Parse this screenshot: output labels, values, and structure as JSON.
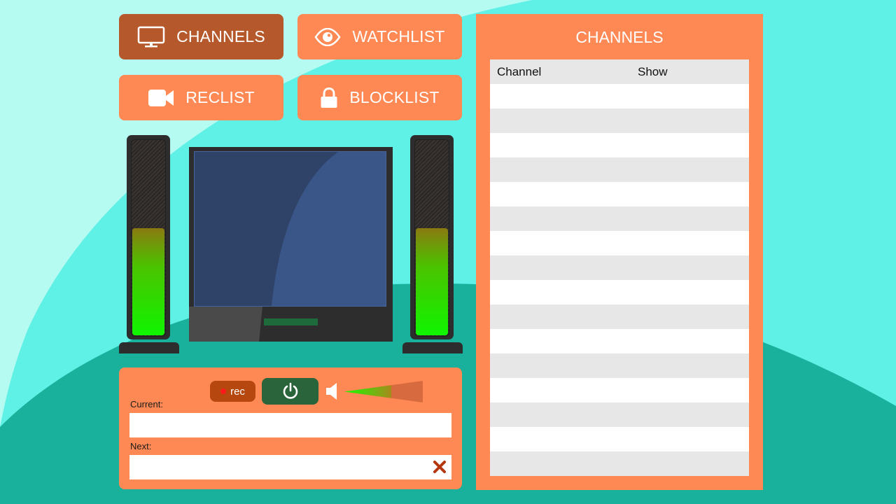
{
  "nav": {
    "channels_label": "CHANNELS",
    "watchlist_label": "WATCHLIST",
    "reclist_label": "RECLIST",
    "blocklist_label": "BLOCKLIST",
    "active": "channels"
  },
  "speakers": {
    "left_level": 0.55,
    "right_level": 0.55
  },
  "controls": {
    "rec_label": "rec",
    "power_icon": "power-icon",
    "volume_icon": "speaker-volume-icon",
    "volume_level": 0.6,
    "current_label": "Current:",
    "current_value": "",
    "next_label": "Next:",
    "next_value": "",
    "clear_icon": "close-icon"
  },
  "channels_panel": {
    "title": "CHANNELS",
    "columns": [
      "Channel",
      "Show"
    ],
    "rows": [
      [
        "",
        ""
      ],
      [
        "",
        ""
      ],
      [
        "",
        ""
      ],
      [
        "",
        ""
      ],
      [
        "",
        ""
      ],
      [
        "",
        ""
      ],
      [
        "",
        ""
      ],
      [
        "",
        ""
      ],
      [
        "",
        ""
      ],
      [
        "",
        ""
      ],
      [
        "",
        ""
      ],
      [
        "",
        ""
      ],
      [
        "",
        ""
      ],
      [
        "",
        ""
      ],
      [
        "",
        ""
      ],
      [
        "",
        ""
      ]
    ]
  },
  "colors": {
    "accent": "#ff8954",
    "active_button": "#b5592c",
    "power_button": "#2a643a",
    "rec_button": "#b5470f",
    "background_light": "#5ff0e6",
    "background_dark": "#19b19c"
  }
}
